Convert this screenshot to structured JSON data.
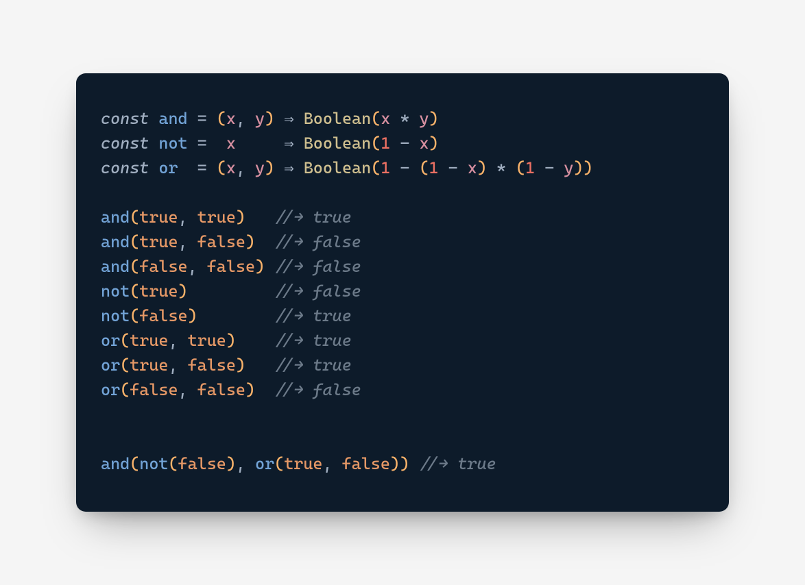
{
  "colors": {
    "background_page": "#f5f5f5",
    "background_card": "#0d1b2a",
    "keyword": "#a0aec0",
    "function": "#72a3d6",
    "operator": "#a0aec0",
    "paren": "#f8b26a",
    "variable": "#d68fa0",
    "punctuation": "#a0aec0",
    "type": "#cfbf8f",
    "number": "#ec7063",
    "boolean": "#e59866",
    "comment": "#6c7a89"
  },
  "code": {
    "lines": [
      [
        {
          "t": "const",
          "c": "kw"
        },
        {
          "t": " "
        },
        {
          "t": "and",
          "c": "fn"
        },
        {
          "t": " "
        },
        {
          "t": "=",
          "c": "op"
        },
        {
          "t": " "
        },
        {
          "t": "(",
          "c": "par"
        },
        {
          "t": "x",
          "c": "var"
        },
        {
          "t": ",",
          "c": "punc"
        },
        {
          "t": " "
        },
        {
          "t": "y",
          "c": "var"
        },
        {
          "t": ")",
          "c": "par"
        },
        {
          "t": " "
        },
        {
          "t": "⇒",
          "c": "op"
        },
        {
          "t": " "
        },
        {
          "t": "Boolean",
          "c": "type"
        },
        {
          "t": "(",
          "c": "par"
        },
        {
          "t": "x",
          "c": "var"
        },
        {
          "t": " "
        },
        {
          "t": "*",
          "c": "op"
        },
        {
          "t": " "
        },
        {
          "t": "y",
          "c": "var"
        },
        {
          "t": ")",
          "c": "par"
        }
      ],
      [
        {
          "t": "const",
          "c": "kw"
        },
        {
          "t": " "
        },
        {
          "t": "not",
          "c": "fn"
        },
        {
          "t": " "
        },
        {
          "t": "=",
          "c": "op"
        },
        {
          "t": "  "
        },
        {
          "t": "x",
          "c": "var"
        },
        {
          "t": "     "
        },
        {
          "t": "⇒",
          "c": "op"
        },
        {
          "t": " "
        },
        {
          "t": "Boolean",
          "c": "type"
        },
        {
          "t": "(",
          "c": "par"
        },
        {
          "t": "1",
          "c": "num"
        },
        {
          "t": " "
        },
        {
          "t": "-",
          "c": "op"
        },
        {
          "t": " "
        },
        {
          "t": "x",
          "c": "var"
        },
        {
          "t": ")",
          "c": "par"
        }
      ],
      [
        {
          "t": "const",
          "c": "kw"
        },
        {
          "t": " "
        },
        {
          "t": "or",
          "c": "fn"
        },
        {
          "t": "  "
        },
        {
          "t": "=",
          "c": "op"
        },
        {
          "t": " "
        },
        {
          "t": "(",
          "c": "par"
        },
        {
          "t": "x",
          "c": "var"
        },
        {
          "t": ",",
          "c": "punc"
        },
        {
          "t": " "
        },
        {
          "t": "y",
          "c": "var"
        },
        {
          "t": ")",
          "c": "par"
        },
        {
          "t": " "
        },
        {
          "t": "⇒",
          "c": "op"
        },
        {
          "t": " "
        },
        {
          "t": "Boolean",
          "c": "type"
        },
        {
          "t": "(",
          "c": "par"
        },
        {
          "t": "1",
          "c": "num"
        },
        {
          "t": " "
        },
        {
          "t": "-",
          "c": "op"
        },
        {
          "t": " "
        },
        {
          "t": "(",
          "c": "par"
        },
        {
          "t": "1",
          "c": "num"
        },
        {
          "t": " "
        },
        {
          "t": "-",
          "c": "op"
        },
        {
          "t": " "
        },
        {
          "t": "x",
          "c": "var"
        },
        {
          "t": ")",
          "c": "par"
        },
        {
          "t": " "
        },
        {
          "t": "*",
          "c": "op"
        },
        {
          "t": " "
        },
        {
          "t": "(",
          "c": "par"
        },
        {
          "t": "1",
          "c": "num"
        },
        {
          "t": " "
        },
        {
          "t": "-",
          "c": "op"
        },
        {
          "t": " "
        },
        {
          "t": "y",
          "c": "var"
        },
        {
          "t": "))",
          "c": "par"
        }
      ],
      [],
      [
        {
          "t": "and",
          "c": "fn"
        },
        {
          "t": "(",
          "c": "par"
        },
        {
          "t": "true",
          "c": "bool"
        },
        {
          "t": ",",
          "c": "punc"
        },
        {
          "t": " "
        },
        {
          "t": "true",
          "c": "bool"
        },
        {
          "t": ")",
          "c": "par"
        },
        {
          "t": "   "
        },
        {
          "t": "//→ true",
          "c": "cmt"
        }
      ],
      [
        {
          "t": "and",
          "c": "fn"
        },
        {
          "t": "(",
          "c": "par"
        },
        {
          "t": "true",
          "c": "bool"
        },
        {
          "t": ",",
          "c": "punc"
        },
        {
          "t": " "
        },
        {
          "t": "false",
          "c": "bool"
        },
        {
          "t": ")",
          "c": "par"
        },
        {
          "t": "  "
        },
        {
          "t": "//→ false",
          "c": "cmt"
        }
      ],
      [
        {
          "t": "and",
          "c": "fn"
        },
        {
          "t": "(",
          "c": "par"
        },
        {
          "t": "false",
          "c": "bool"
        },
        {
          "t": ",",
          "c": "punc"
        },
        {
          "t": " "
        },
        {
          "t": "false",
          "c": "bool"
        },
        {
          "t": ")",
          "c": "par"
        },
        {
          "t": " "
        },
        {
          "t": "//→ false",
          "c": "cmt"
        }
      ],
      [
        {
          "t": "not",
          "c": "fn"
        },
        {
          "t": "(",
          "c": "par"
        },
        {
          "t": "true",
          "c": "bool"
        },
        {
          "t": ")",
          "c": "par"
        },
        {
          "t": "         "
        },
        {
          "t": "//→ false",
          "c": "cmt"
        }
      ],
      [
        {
          "t": "not",
          "c": "fn"
        },
        {
          "t": "(",
          "c": "par"
        },
        {
          "t": "false",
          "c": "bool"
        },
        {
          "t": ")",
          "c": "par"
        },
        {
          "t": "        "
        },
        {
          "t": "//→ true",
          "c": "cmt"
        }
      ],
      [
        {
          "t": "or",
          "c": "fn"
        },
        {
          "t": "(",
          "c": "par"
        },
        {
          "t": "true",
          "c": "bool"
        },
        {
          "t": ",",
          "c": "punc"
        },
        {
          "t": " "
        },
        {
          "t": "true",
          "c": "bool"
        },
        {
          "t": ")",
          "c": "par"
        },
        {
          "t": "    "
        },
        {
          "t": "//→ true",
          "c": "cmt"
        }
      ],
      [
        {
          "t": "or",
          "c": "fn"
        },
        {
          "t": "(",
          "c": "par"
        },
        {
          "t": "true",
          "c": "bool"
        },
        {
          "t": ",",
          "c": "punc"
        },
        {
          "t": " "
        },
        {
          "t": "false",
          "c": "bool"
        },
        {
          "t": ")",
          "c": "par"
        },
        {
          "t": "   "
        },
        {
          "t": "//→ true",
          "c": "cmt"
        }
      ],
      [
        {
          "t": "or",
          "c": "fn"
        },
        {
          "t": "(",
          "c": "par"
        },
        {
          "t": "false",
          "c": "bool"
        },
        {
          "t": ",",
          "c": "punc"
        },
        {
          "t": " "
        },
        {
          "t": "false",
          "c": "bool"
        },
        {
          "t": ")",
          "c": "par"
        },
        {
          "t": "  "
        },
        {
          "t": "//→ false",
          "c": "cmt"
        }
      ],
      [],
      [],
      [
        {
          "t": "and",
          "c": "fn"
        },
        {
          "t": "(",
          "c": "par"
        },
        {
          "t": "not",
          "c": "fn"
        },
        {
          "t": "(",
          "c": "par"
        },
        {
          "t": "false",
          "c": "bool"
        },
        {
          "t": ")",
          "c": "par"
        },
        {
          "t": ",",
          "c": "punc"
        },
        {
          "t": " "
        },
        {
          "t": "or",
          "c": "fn"
        },
        {
          "t": "(",
          "c": "par"
        },
        {
          "t": "true",
          "c": "bool"
        },
        {
          "t": ",",
          "c": "punc"
        },
        {
          "t": " "
        },
        {
          "t": "false",
          "c": "bool"
        },
        {
          "t": "))",
          "c": "par"
        },
        {
          "t": " "
        },
        {
          "t": "//→ true",
          "c": "cmt"
        }
      ]
    ]
  }
}
